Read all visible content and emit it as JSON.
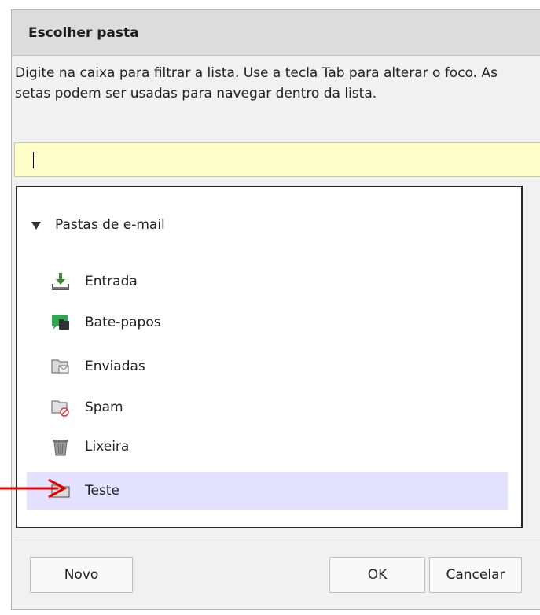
{
  "dialog": {
    "title": "Escolher pasta",
    "instructions": "Digite na caixa para filtrar a lista. Use a tecla Tab para alterar o foco. As setas podem ser usadas para navegar dentro da lista.",
    "search": {
      "value": "",
      "placeholder": ""
    }
  },
  "folders": {
    "group_label": "Pastas de e-mail",
    "items": [
      {
        "label": "Entrada",
        "icon": "inbox-download-icon"
      },
      {
        "label": "Bate-papos",
        "icon": "chat-folder-icon"
      },
      {
        "label": "Enviadas",
        "icon": "sent-folder-icon"
      },
      {
        "label": "Spam",
        "icon": "spam-folder-icon"
      },
      {
        "label": "Lixeira",
        "icon": "trash-icon"
      },
      {
        "label": "Teste",
        "icon": "folder-icon",
        "selected": true
      }
    ]
  },
  "buttons": {
    "new": "Novo",
    "ok": "OK",
    "cancel": "Cancelar"
  },
  "colors": {
    "selection": "#e4e0ff",
    "search_bg": "#ffffc9",
    "annotation_arrow": "#e00000",
    "chat_green": "#2fa84f"
  }
}
